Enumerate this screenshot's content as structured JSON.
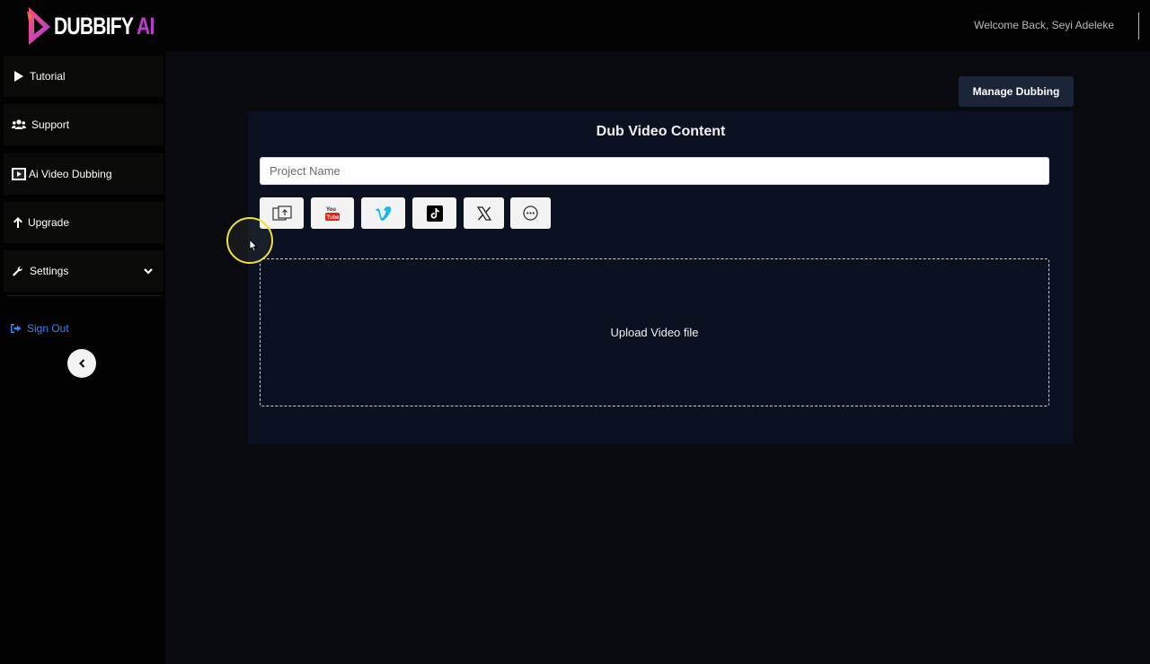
{
  "app": {
    "logo_text": "DUBBIFY",
    "logo_suffix": "AI",
    "welcome": "Welcome Back, Seyi Adeleke"
  },
  "sidebar": {
    "items": [
      {
        "label": "Tutorial",
        "icon": "play-icon"
      },
      {
        "label": "Support",
        "icon": "users-icon"
      },
      {
        "label": "Ai Video Dubbing",
        "icon": "video-icon"
      },
      {
        "label": "Upgrade",
        "icon": "arrow-up-icon"
      },
      {
        "label": "Settings",
        "icon": "wrench-icon"
      }
    ],
    "sign_out": "Sign Out"
  },
  "main": {
    "manage_button": "Manage Dubbing",
    "title": "Dub Video Content",
    "project_placeholder": "Project Name",
    "sources": [
      "upload-file-icon",
      "youtube-icon",
      "vimeo-icon",
      "tiktok-icon",
      "x-icon",
      "more-icon"
    ],
    "dropzone_label": "Upload Video file"
  },
  "colors": {
    "accent_blue": "#3b82f6",
    "button_navy": "#1b2538",
    "card_bg": "#0b1120",
    "logo_purple": "#c23bd4"
  }
}
